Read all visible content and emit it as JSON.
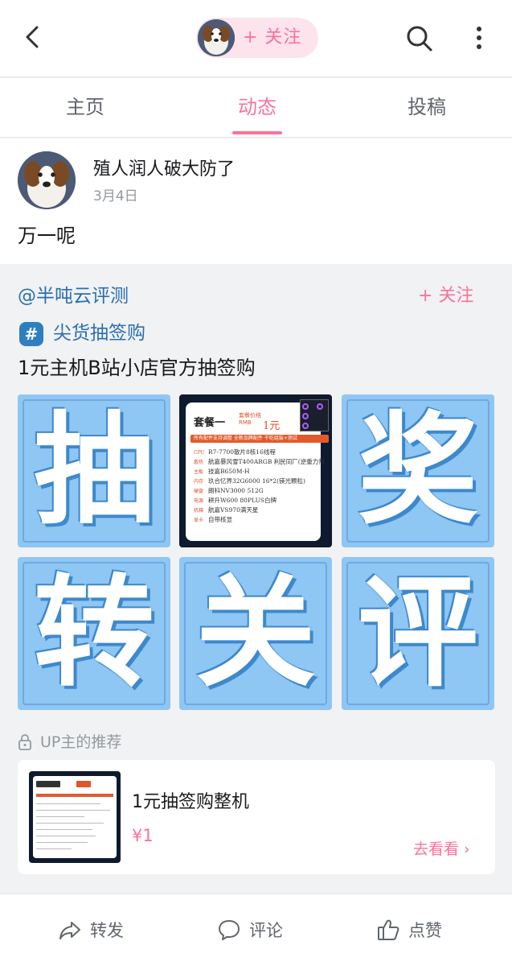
{
  "header": {
    "follow_label": "+ 关注"
  },
  "tabs": [
    {
      "label": "主页"
    },
    {
      "label": "动态"
    },
    {
      "label": "投稿"
    }
  ],
  "post": {
    "author": "殖人润人破大防了",
    "date": "3月4日",
    "text": "万一呢"
  },
  "forward": {
    "user": "@半吨云评测",
    "follow": "+ 关注",
    "topic": "尖货抽签购",
    "topic_icon": "#",
    "description": "1元主机B站小店官方抽签购",
    "grid_chars": [
      "抽",
      "奖",
      "转",
      "关",
      "评"
    ],
    "package_card": {
      "title": "套餐一",
      "price_label": "套餐价格 RMB",
      "price": "1元",
      "bar_text": "所有配件支持调整  全新品牌配件  干吃组装+测试",
      "rows": [
        {
          "k": "CPU",
          "v": "R7-7700散片8核16线程"
        },
        {
          "k": "散热",
          "v": "航嘉暴风雪T400ARGB 利民同厂(逆重力热"
        },
        {
          "k": "主板",
          "v": "技嘉B650M-H"
        },
        {
          "k": "内存",
          "v": "玖合忆界32G6000 16*2(镁光颗粒)"
        },
        {
          "k": "硬盘",
          "v": "朗科NV3000 512G"
        },
        {
          "k": "电源",
          "v": "耕升W600 80PLUS白牌"
        },
        {
          "k": "机箱",
          "v": "航嘉VS970满天星"
        },
        {
          "k": "显卡",
          "v": "自带核显"
        }
      ]
    },
    "recommend_label": "UP主的推荐",
    "recommend": {
      "title": "1元抽签购整机",
      "price": "¥1",
      "link": "去看看 ›"
    }
  },
  "actions": [
    {
      "label": "转发",
      "icon": "share-icon"
    },
    {
      "label": "评论",
      "icon": "comment-icon"
    },
    {
      "label": "点赞",
      "icon": "like-icon"
    }
  ],
  "colors": {
    "accent": "#fb7299",
    "link": "#2a6fb0",
    "tile_blue": "#8ec6f4"
  }
}
